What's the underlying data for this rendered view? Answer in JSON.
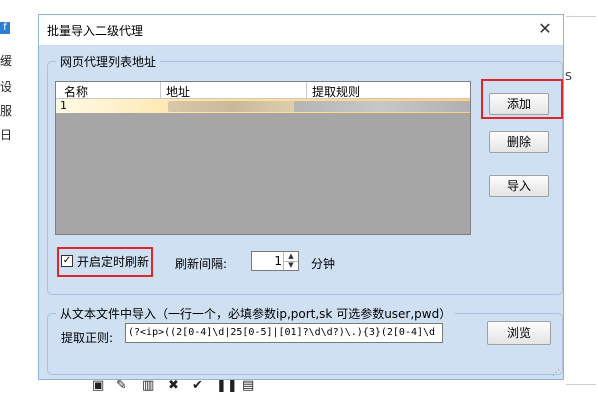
{
  "background": {
    "tab_letter": "f",
    "left_chars": [
      "缓",
      "设",
      "服",
      "日"
    ],
    "right_char": "S"
  },
  "dialog": {
    "title": "批量导入二级代理",
    "close_glyph": "✕"
  },
  "proxy_group": {
    "legend": "网页代理列表地址",
    "columns": [
      "名称",
      "地址",
      "提取规则"
    ],
    "rows": [
      {
        "name": "1",
        "address": "",
        "rule": ""
      }
    ],
    "buttons": {
      "add": "添加",
      "delete": "删除",
      "import": "导入"
    },
    "timer": {
      "checked": true,
      "label": "开启定时刷新",
      "interval_label": "刷新间隔:",
      "interval_value": "1",
      "unit": "分钟"
    }
  },
  "file_group": {
    "legend": "从文本文件中导入（一行一个，必填参数ip,port,sk 可选参数user,pwd）",
    "regex_label": "提取正则:",
    "regex_value": "(?<ip>((2[0-4]\\d|25[0-5]|[01]?\\d\\d?)\\.){3}(2[0-4]\\d",
    "browse_label": "浏览"
  },
  "highlight_color": "#e0262a",
  "accent_color": "#cfe0f3"
}
